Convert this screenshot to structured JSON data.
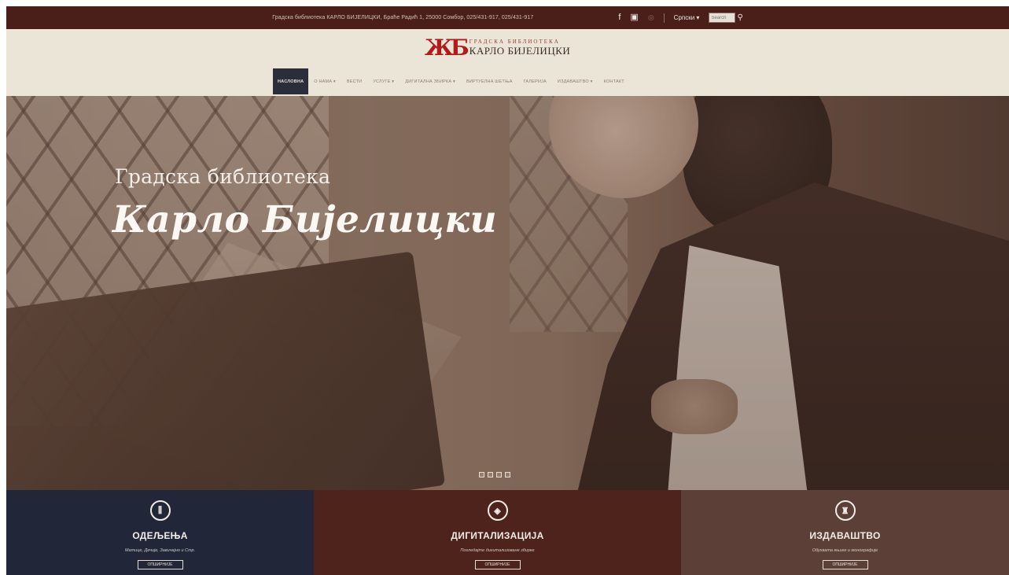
{
  "topbar": {
    "info": "Градска библиотека КАРЛО БИЈЕЛИЦКИ, Браће Радић 1, 25000 Сомбор, 025/431-917, 025/431-917",
    "lang_label": "Српски ▾",
    "search_placeholder": "Search",
    "icons": [
      "facebook-icon",
      "youtube-icon",
      "instagram-icon",
      "search-icon"
    ]
  },
  "logo": {
    "mark": "ЖБ",
    "line1": "ГРАДСКА БИБЛИОТЕКА",
    "line2": "КАРЛО БИЈЕЛИЦКИ"
  },
  "nav": {
    "items": [
      {
        "label": "НАСЛОВНА",
        "active": true
      },
      {
        "label": "О НАМА ▾"
      },
      {
        "label": "ВЕСТИ"
      },
      {
        "label": "УСЛУГЕ ▾"
      },
      {
        "label": "ДИГИТАЛНА ЗБИРКА ▾"
      },
      {
        "label": "ВИРТУЕЛНА ШЕТЊА"
      },
      {
        "label": "ГАЛЕРИЈА"
      },
      {
        "label": "ИЗДАВАШТВО ▾"
      },
      {
        "label": "КОНТАКТ"
      }
    ]
  },
  "hero": {
    "subtitle": "Градска библиотека",
    "title": "Карло Бијелицки",
    "slide_count": 4
  },
  "features": [
    {
      "icon": "books-icon",
      "title": "ОДЕЉЕЊА",
      "desc": "Матице, Дечије, Завичајно и Стр.",
      "button": "ОПШИРНИЈЕ"
    },
    {
      "icon": "digital-icon",
      "title": "ДИГИТАЛИЗАЦИЈА",
      "desc": "Погледајте дигитализоване збирке",
      "button": "ОПШИРНИЈЕ"
    },
    {
      "icon": "chair-icon",
      "title": "ИЗДАВАШТВО",
      "desc": "Обухвата књиге и монографије",
      "button": "ОПШИРНИЈЕ"
    }
  ],
  "colors": {
    "topbar": "#4a1f1a",
    "header": "#ebe5d8",
    "nav_active": "#2b2d3a",
    "feature_1": "#212738",
    "feature_2": "#4d231c",
    "feature_3": "#5c4038",
    "logo_red": "#b31a1a"
  }
}
